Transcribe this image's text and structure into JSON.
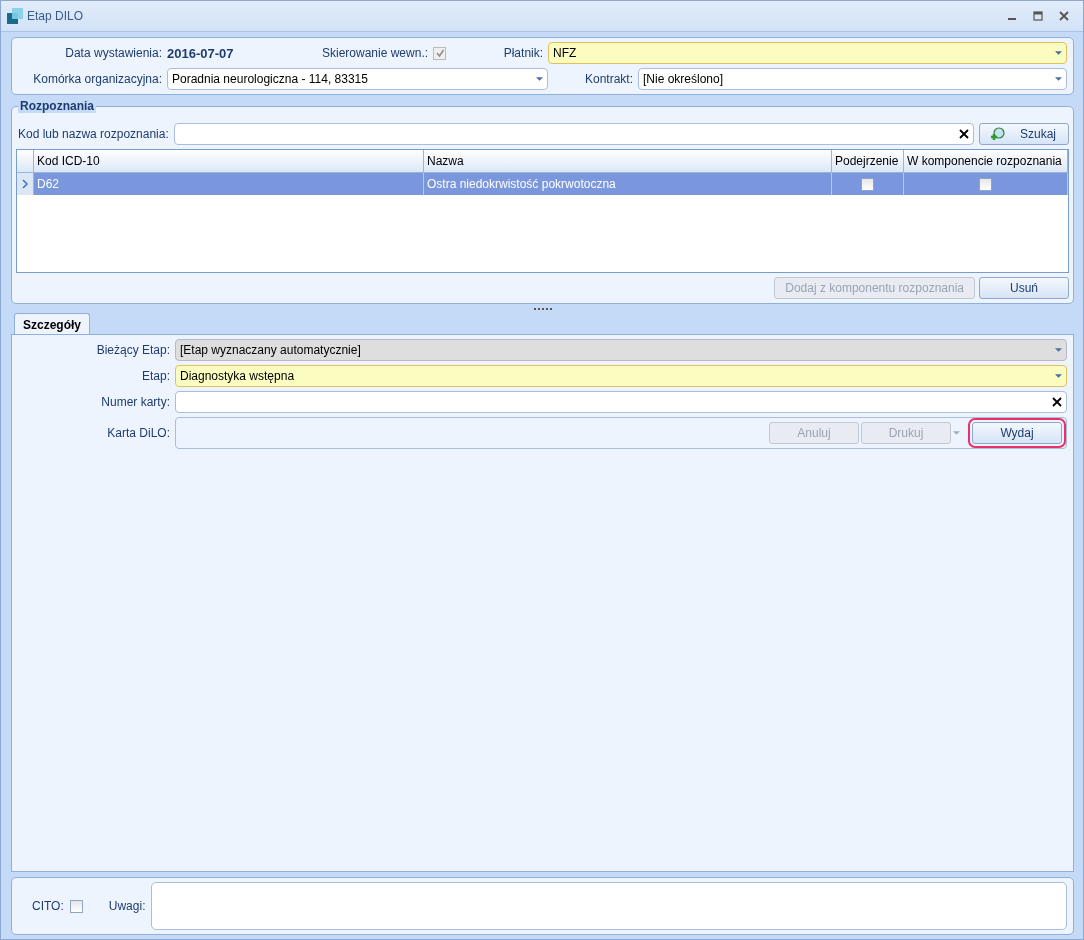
{
  "window": {
    "title": "Etap DILO"
  },
  "header": {
    "date": {
      "label": "Data wystawienia:",
      "value": "2016-07-07"
    },
    "internal_referral": {
      "label": "Skierowanie wewn.:",
      "checked": true,
      "disabled": true
    },
    "unit": {
      "label": "Komórka organizacyjna:",
      "value": "Poradnia neurologiczna - 114, 83315",
      "required": false
    },
    "payer": {
      "label": "Płatnik:",
      "value": "NFZ",
      "required": true
    },
    "contract": {
      "label": "Kontrakt:",
      "value": "[Nie określono]",
      "required": false
    }
  },
  "diagnoses": {
    "title": "Rozpoznania",
    "search_label": "Kod lub nazwa rozpoznania:",
    "search_button": "Szukaj",
    "columns": [
      "Kod ICD-10",
      "Nazwa",
      "Podejrzenie",
      "W komponencie rozpoznania"
    ],
    "rows": [
      {
        "code": "D62",
        "name": "Ostra niedokrwistość pokrwotoczna",
        "suspected": false,
        "in_component": false,
        "selected": true
      }
    ],
    "buttons": [
      {
        "label": "Dodaj z komponentu rozpoznania",
        "disabled": true
      },
      {
        "label": "Usuń",
        "disabled": false
      }
    ]
  },
  "tabs": [
    {
      "label": "Szczegóły",
      "selected": true
    }
  ],
  "details": {
    "current_stage": {
      "label": "Bieżący Etap:",
      "value": "[Etap wyznaczany automatycznie]",
      "disabled": true
    },
    "stage": {
      "label": "Etap:",
      "value": "Diagnostyka wstępna",
      "disabled": false,
      "required": true
    },
    "card_number": {
      "label": "Numer karty:"
    },
    "card": {
      "label": "Karta DiLO:",
      "buttons": [
        {
          "label": "Anuluj",
          "disabled": true,
          "dropdown": false,
          "highlighted": false
        },
        {
          "label": "Drukuj",
          "disabled": true,
          "dropdown": true,
          "highlighted": false
        },
        {
          "label": "Wydaj",
          "disabled": false,
          "dropdown": false,
          "highlighted": true
        }
      ]
    }
  },
  "footer": {
    "cito": {
      "label": "CITO:",
      "checked": false
    },
    "notes_label": "Uwagi:"
  }
}
